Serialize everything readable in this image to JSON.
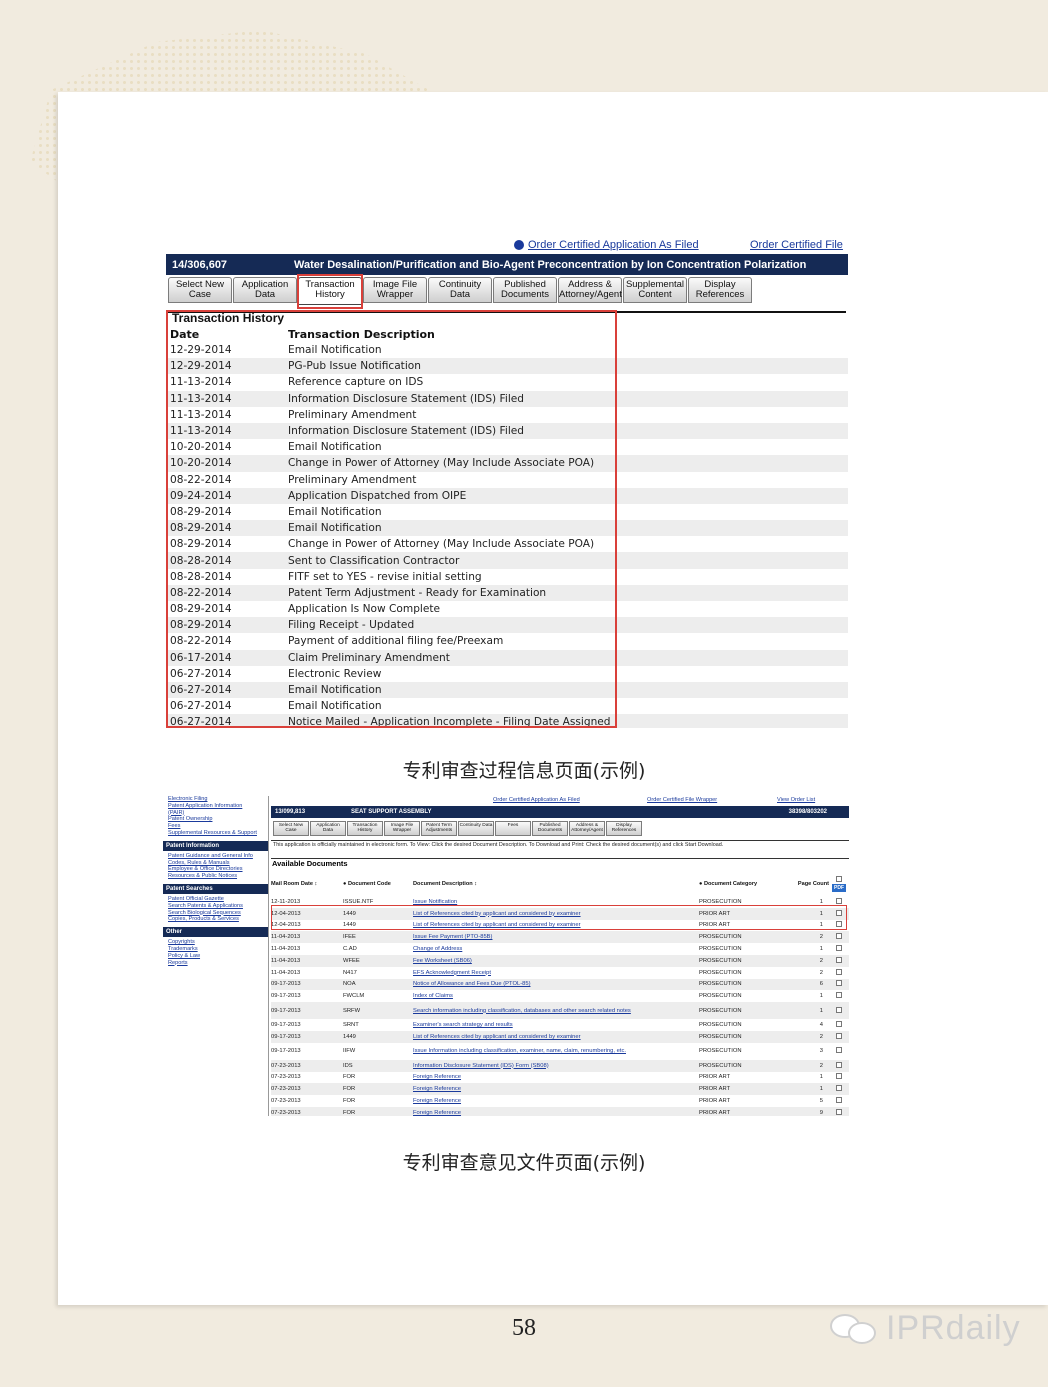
{
  "page_number": "58",
  "captions": {
    "first": "专利审查过程信息页面(示例)",
    "second": "专利审查意见文件页面(示例)"
  },
  "watermark": "IPRdaily",
  "shot1": {
    "top_link_left": "Order Certified Application As Filed",
    "top_link_right": "Order Certified File",
    "app_number": "14/306,607",
    "title": "Water Desalination/Purification and Bio-Agent Preconcentration by Ion Concentration Polarization",
    "tabs": [
      {
        "label": "Select New Case"
      },
      {
        "label": "Application Data"
      },
      {
        "label": "Transaction History"
      },
      {
        "label": "Image File Wrapper"
      },
      {
        "label": "Continuity Data"
      },
      {
        "label": "Published Documents"
      },
      {
        "label": "Address & Attorney/Agent"
      },
      {
        "label": "Supplemental Content"
      },
      {
        "label": "Display References"
      }
    ],
    "section_title": "Transaction History",
    "columns": [
      "Date",
      "Transaction Description"
    ],
    "rows": [
      [
        "12-29-2014",
        "Email Notification"
      ],
      [
        "12-29-2014",
        "PG-Pub Issue Notification"
      ],
      [
        "11-13-2014",
        "Reference capture on IDS"
      ],
      [
        "11-13-2014",
        "Information Disclosure Statement (IDS) Filed"
      ],
      [
        "11-13-2014",
        "Preliminary Amendment"
      ],
      [
        "11-13-2014",
        "Information Disclosure Statement (IDS) Filed"
      ],
      [
        "10-20-2014",
        "Email Notification"
      ],
      [
        "10-20-2014",
        "Change in Power of Attorney (May Include Associate POA)"
      ],
      [
        "08-22-2014",
        "Preliminary Amendment"
      ],
      [
        "09-24-2014",
        "Application Dispatched from OIPE"
      ],
      [
        "08-29-2014",
        "Email Notification"
      ],
      [
        "08-29-2014",
        "Email Notification"
      ],
      [
        "08-29-2014",
        "Change in Power of Attorney (May Include Associate POA)"
      ],
      [
        "08-28-2014",
        "Sent to Classification Contractor"
      ],
      [
        "08-28-2014",
        "FITF set to YES - revise initial setting"
      ],
      [
        "08-22-2014",
        "Patent Term Adjustment - Ready for Examination"
      ],
      [
        "08-29-2014",
        "Application Is Now Complete"
      ],
      [
        "08-29-2014",
        "Filing Receipt - Updated"
      ],
      [
        "08-22-2014",
        "Payment of additional filing fee/Preexam"
      ],
      [
        "06-17-2014",
        "Claim Preliminary Amendment"
      ],
      [
        "06-27-2014",
        "Electronic Review"
      ],
      [
        "06-27-2014",
        "Email Notification"
      ],
      [
        "06-27-2014",
        "Email Notification"
      ],
      [
        "06-27-2014",
        "Notice Mailed - Application Incomplete - Filing Date Assigned"
      ]
    ]
  },
  "shot2": {
    "sidebar": {
      "links_top": [
        "Electronic Filing",
        "Patent Application Information",
        "(PAIR)",
        "Patent Ownership",
        "Fees",
        "Supplemental Resources & Support"
      ],
      "sections": [
        {
          "heading": "Patent Information",
          "links": [
            "Patent Guidance and General Info",
            "Codes, Rules & Manuals",
            "Employee & Office Directories",
            "Resources & Public Notices"
          ]
        },
        {
          "heading": "Patent Searches",
          "links": [
            "Patent Official Gazette",
            "Search Patents & Applications",
            "Search Biological Sequences",
            "Copies, Products & Services"
          ]
        },
        {
          "heading": "Other",
          "links": [
            "Copyrights",
            "Trademarks",
            "Policy & Law",
            "Reports"
          ]
        }
      ]
    },
    "top_links": [
      "Order Certified Application As Filed",
      "Order Certified File Wrapper",
      "View Order List"
    ],
    "app_number": "13/099,813",
    "title": "SEAT SUPPORT ASSEMBLY",
    "docket": "38398/803202",
    "tabs": [
      "Select New Case",
      "Application Data",
      "Transaction History",
      "Image File Wrapper",
      "Patent Term Adjustments",
      "Continuity Data",
      "Fees",
      "Published Documents",
      "Address & Attorney/Agent",
      "Display References"
    ],
    "info": "This application is officially maintained in electronic form. To View: Click the desired Document Description. To Download and Print: Check the desired document(s) and click Start Download.",
    "available": "Available Documents",
    "headers": {
      "mail_date": "Mail Room Date",
      "code": "Document Code",
      "desc": "Document Description",
      "category": "Document Category",
      "pages": "Page Count",
      "pdf": "PDF"
    },
    "rows": [
      [
        "12-11-2013",
        "ISSUE.NTF",
        "Issue Notification",
        "PROSECUTION",
        "1"
      ],
      [
        "12-04-2013",
        "1449",
        "List of References cited by applicant and considered by examiner",
        "PRIOR ART",
        "1"
      ],
      [
        "12-04-2013",
        "1449",
        "List of References cited by applicant and considered by examiner",
        "PRIOR ART",
        "1"
      ],
      [
        "11-04-2013",
        "IFEE",
        "Issue Fee Payment (PTO-85B)",
        "PROSECUTION",
        "2"
      ],
      [
        "11-04-2013",
        "C.AD",
        "Change of Address",
        "PROSECUTION",
        "1"
      ],
      [
        "11-04-2013",
        "WFEE",
        "Fee Worksheet (SB06)",
        "PROSECUTION",
        "2"
      ],
      [
        "11-04-2013",
        "N417",
        "EFS Acknowledgment Receipt",
        "PROSECUTION",
        "2"
      ],
      [
        "09-17-2013",
        "NOA",
        "Notice of Allowance and Fees Due (PTOL-85)",
        "PROSECUTION",
        "6"
      ],
      [
        "09-17-2013",
        "FWCLM",
        "Index of Claims",
        "PROSECUTION",
        "1"
      ],
      [
        "09-17-2013",
        "SRFW",
        "Search information including classification, databases and other search related notes",
        "PROSECUTION",
        "1"
      ],
      [
        "09-17-2013",
        "SRNT",
        "Examiner's search strategy and results",
        "PROSECUTION",
        "4"
      ],
      [
        "09-17-2013",
        "1449",
        "List of References cited by applicant and considered by examiner",
        "PROSECUTION",
        "2"
      ],
      [
        "09-17-2013",
        "IIFW",
        "Issue Information including classification, examiner, name, claim, renumbering, etc.",
        "PROSECUTION",
        "3"
      ],
      [
        "07-23-2013",
        "IDS",
        "Information Disclosure Statement (IDS) Form (SB08)",
        "PROSECUTION",
        "2"
      ],
      [
        "07-23-2013",
        "FOR",
        "Foreign Reference",
        "PRIOR ART",
        "1"
      ],
      [
        "07-23-2013",
        "FOR",
        "Foreign Reference",
        "PRIOR ART",
        "1"
      ],
      [
        "07-23-2013",
        "FOR",
        "Foreign Reference",
        "PRIOR ART",
        "5"
      ],
      [
        "07-23-2013",
        "FOR",
        "Foreign Reference",
        "PRIOR ART",
        "9"
      ]
    ]
  }
}
